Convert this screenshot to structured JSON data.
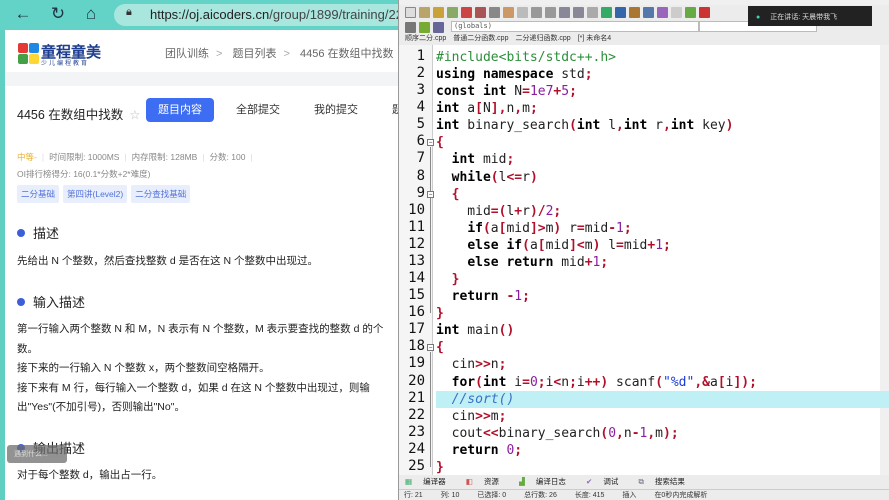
{
  "browser": {
    "url_host": "https://oj.aicoders.cn",
    "url_path": "/group/1899/training/22241/p"
  },
  "logo": {
    "name": "童程童美",
    "sub": "少儿编程教育"
  },
  "breadcrumb": [
    "团队训练",
    "题目列表",
    "4456 在数组中找数"
  ],
  "problem": {
    "title": "4456 在数组中找数",
    "tabs": [
      "题目内容",
      "全部提交",
      "我的提交",
      "题目统计"
    ],
    "level": "中等-",
    "time_limit": "时间限制: 1000MS",
    "memory_limit": "内存限制: 128MB",
    "score": "分数: 100",
    "rank_score": "OI排行榜得分: 16(0.1*分数+2*难度)",
    "tags": [
      "二分基础",
      "第四讲(Level2)",
      "二分查找基础"
    ],
    "desc_title": "描述",
    "desc": "先给出 N 个整数，然后查找整数 d 是否在这 N 个整数中出现过。",
    "input_title": "输入描述",
    "input": [
      "第一行输入两个整数 N 和 M，N 表示有 N 个整数，M 表示要查找的整数 d 的个数。",
      "接下来的一行输入 N 个整数 x，两个整数间空格隔开。",
      "接下来有 M 行，每行输入一个整数 d，如果 d 在这 N 个整数中出现过，则输出\"Yes\"(不加引号)，否则输出\"No\"。"
    ],
    "output_title": "输出描述",
    "output": "对于每个整数 d，输出占一行。",
    "float_btn": "遇到什么..."
  },
  "editor": {
    "scope": "(globals)",
    "files": [
      "顺序二分.cpp",
      "普通二分函数.cpp",
      "二分递归函数.cpp",
      "[*] 未命名4"
    ],
    "current_line": 21,
    "lines": [
      [
        [
          "p",
          "#include<bits/stdc++.h>"
        ]
      ],
      [
        [
          "k",
          "using namespace"
        ],
        [
          "t",
          " std"
        ],
        [
          "o",
          ";"
        ]
      ],
      [
        [
          "k",
          "const int"
        ],
        [
          "t",
          " N"
        ],
        [
          "o",
          "="
        ],
        [
          "n",
          "1e7"
        ],
        [
          "o",
          "+"
        ],
        [
          "n",
          "5"
        ],
        [
          "o",
          ";"
        ]
      ],
      [
        [
          "k",
          "int"
        ],
        [
          "t",
          " a"
        ],
        [
          "o",
          "["
        ],
        [
          "t",
          "N"
        ],
        [
          "o",
          "],"
        ],
        [
          "t",
          "n"
        ],
        [
          "o",
          ","
        ],
        [
          "t",
          "m"
        ],
        [
          "o",
          ";"
        ]
      ],
      [
        [
          "k",
          "int"
        ],
        [
          "t",
          " binary_search"
        ],
        [
          "o",
          "("
        ],
        [
          "k",
          "int"
        ],
        [
          "t",
          " l"
        ],
        [
          "o",
          ","
        ],
        [
          "k",
          "int"
        ],
        [
          "t",
          " r"
        ],
        [
          "o",
          ","
        ],
        [
          "k",
          "int"
        ],
        [
          "t",
          " key"
        ],
        [
          "o",
          ")"
        ]
      ],
      [
        [
          "o",
          "{"
        ]
      ],
      [
        [
          "t",
          "  "
        ],
        [
          "k",
          "int"
        ],
        [
          "t",
          " mid"
        ],
        [
          "o",
          ";"
        ]
      ],
      [
        [
          "t",
          "  "
        ],
        [
          "k",
          "while"
        ],
        [
          "o",
          "("
        ],
        [
          "t",
          "l"
        ],
        [
          "o",
          "<="
        ],
        [
          "t",
          "r"
        ],
        [
          "o",
          ")"
        ]
      ],
      [
        [
          "t",
          "  "
        ],
        [
          "o",
          "{"
        ]
      ],
      [
        [
          "t",
          "    mid"
        ],
        [
          "o",
          "=("
        ],
        [
          "t",
          "l"
        ],
        [
          "o",
          "+"
        ],
        [
          "t",
          "r"
        ],
        [
          "o",
          ")/"
        ],
        [
          "n",
          "2"
        ],
        [
          "o",
          ";"
        ]
      ],
      [
        [
          "t",
          "    "
        ],
        [
          "k",
          "if"
        ],
        [
          "o",
          "("
        ],
        [
          "t",
          "a"
        ],
        [
          "o",
          "["
        ],
        [
          "t",
          "mid"
        ],
        [
          "o",
          "]>"
        ],
        [
          "t",
          "m"
        ],
        [
          "o",
          ")"
        ],
        [
          "t",
          " r"
        ],
        [
          "o",
          "="
        ],
        [
          "t",
          "mid"
        ],
        [
          "o",
          "-"
        ],
        [
          "n",
          "1"
        ],
        [
          "o",
          ";"
        ]
      ],
      [
        [
          "t",
          "    "
        ],
        [
          "k",
          "else if"
        ],
        [
          "o",
          "("
        ],
        [
          "t",
          "a"
        ],
        [
          "o",
          "["
        ],
        [
          "t",
          "mid"
        ],
        [
          "o",
          "]<"
        ],
        [
          "t",
          "m"
        ],
        [
          "o",
          ")"
        ],
        [
          "t",
          " l"
        ],
        [
          "o",
          "="
        ],
        [
          "t",
          "mid"
        ],
        [
          "o",
          "+"
        ],
        [
          "n",
          "1"
        ],
        [
          "o",
          ";"
        ]
      ],
      [
        [
          "t",
          "    "
        ],
        [
          "k",
          "else return"
        ],
        [
          "t",
          " mid"
        ],
        [
          "o",
          "+"
        ],
        [
          "n",
          "1"
        ],
        [
          "o",
          ";"
        ]
      ],
      [
        [
          "t",
          "  "
        ],
        [
          "o",
          "}"
        ]
      ],
      [
        [
          "t",
          "  "
        ],
        [
          "k",
          "return"
        ],
        [
          "t",
          " "
        ],
        [
          "o",
          "-"
        ],
        [
          "n",
          "1"
        ],
        [
          "o",
          ";"
        ]
      ],
      [
        [
          "o",
          "}"
        ]
      ],
      [
        [
          "k",
          "int"
        ],
        [
          "t",
          " main"
        ],
        [
          "o",
          "()"
        ]
      ],
      [
        [
          "o",
          "{"
        ]
      ],
      [
        [
          "t",
          "  cin"
        ],
        [
          "o",
          ">>"
        ],
        [
          "t",
          "n"
        ],
        [
          "o",
          ";"
        ]
      ],
      [
        [
          "t",
          "  "
        ],
        [
          "k",
          "for"
        ],
        [
          "o",
          "("
        ],
        [
          "k",
          "int"
        ],
        [
          "t",
          " i"
        ],
        [
          "o",
          "="
        ],
        [
          "n",
          "0"
        ],
        [
          "o",
          ";"
        ],
        [
          "t",
          "i"
        ],
        [
          "o",
          "<"
        ],
        [
          "t",
          "n"
        ],
        [
          "o",
          ";"
        ],
        [
          "t",
          "i"
        ],
        [
          "o",
          "++)"
        ],
        [
          "t",
          " scanf"
        ],
        [
          "o",
          "("
        ],
        [
          "s",
          "\"%d\""
        ],
        [
          "o",
          ",&"
        ],
        [
          "t",
          "a"
        ],
        [
          "o",
          "["
        ],
        [
          "t",
          "i"
        ],
        [
          "o",
          "]);"
        ]
      ],
      [
        [
          "t",
          "  "
        ],
        [
          "c",
          "//sort()"
        ]
      ],
      [
        [
          "t",
          "  cin"
        ],
        [
          "o",
          ">>"
        ],
        [
          "t",
          "m"
        ],
        [
          "o",
          ";"
        ]
      ],
      [
        [
          "t",
          "  cout"
        ],
        [
          "o",
          "<<"
        ],
        [
          "t",
          "binary_search"
        ],
        [
          "o",
          "("
        ],
        [
          "n",
          "0"
        ],
        [
          "o",
          ","
        ],
        [
          "t",
          "n"
        ],
        [
          "o",
          "-"
        ],
        [
          "n",
          "1"
        ],
        [
          "o",
          ","
        ],
        [
          "t",
          "m"
        ],
        [
          "o",
          ");"
        ]
      ],
      [
        [
          "t",
          "  "
        ],
        [
          "k",
          "return"
        ],
        [
          "t",
          " "
        ],
        [
          "n",
          "0"
        ],
        [
          "o",
          ";"
        ]
      ],
      [
        [
          "o",
          "}"
        ]
      ]
    ],
    "bottom_tabs": [
      "编译器",
      "资源",
      "编译日志",
      "调试",
      "搜索结果"
    ],
    "status": [
      "行: 21",
      "列: 10",
      "已选择: 0",
      "总行数: 26",
      "长度: 415",
      "插入",
      "在0秒内完成解析"
    ]
  },
  "toast": {
    "text": "正在讲话: 天晨带我飞"
  }
}
